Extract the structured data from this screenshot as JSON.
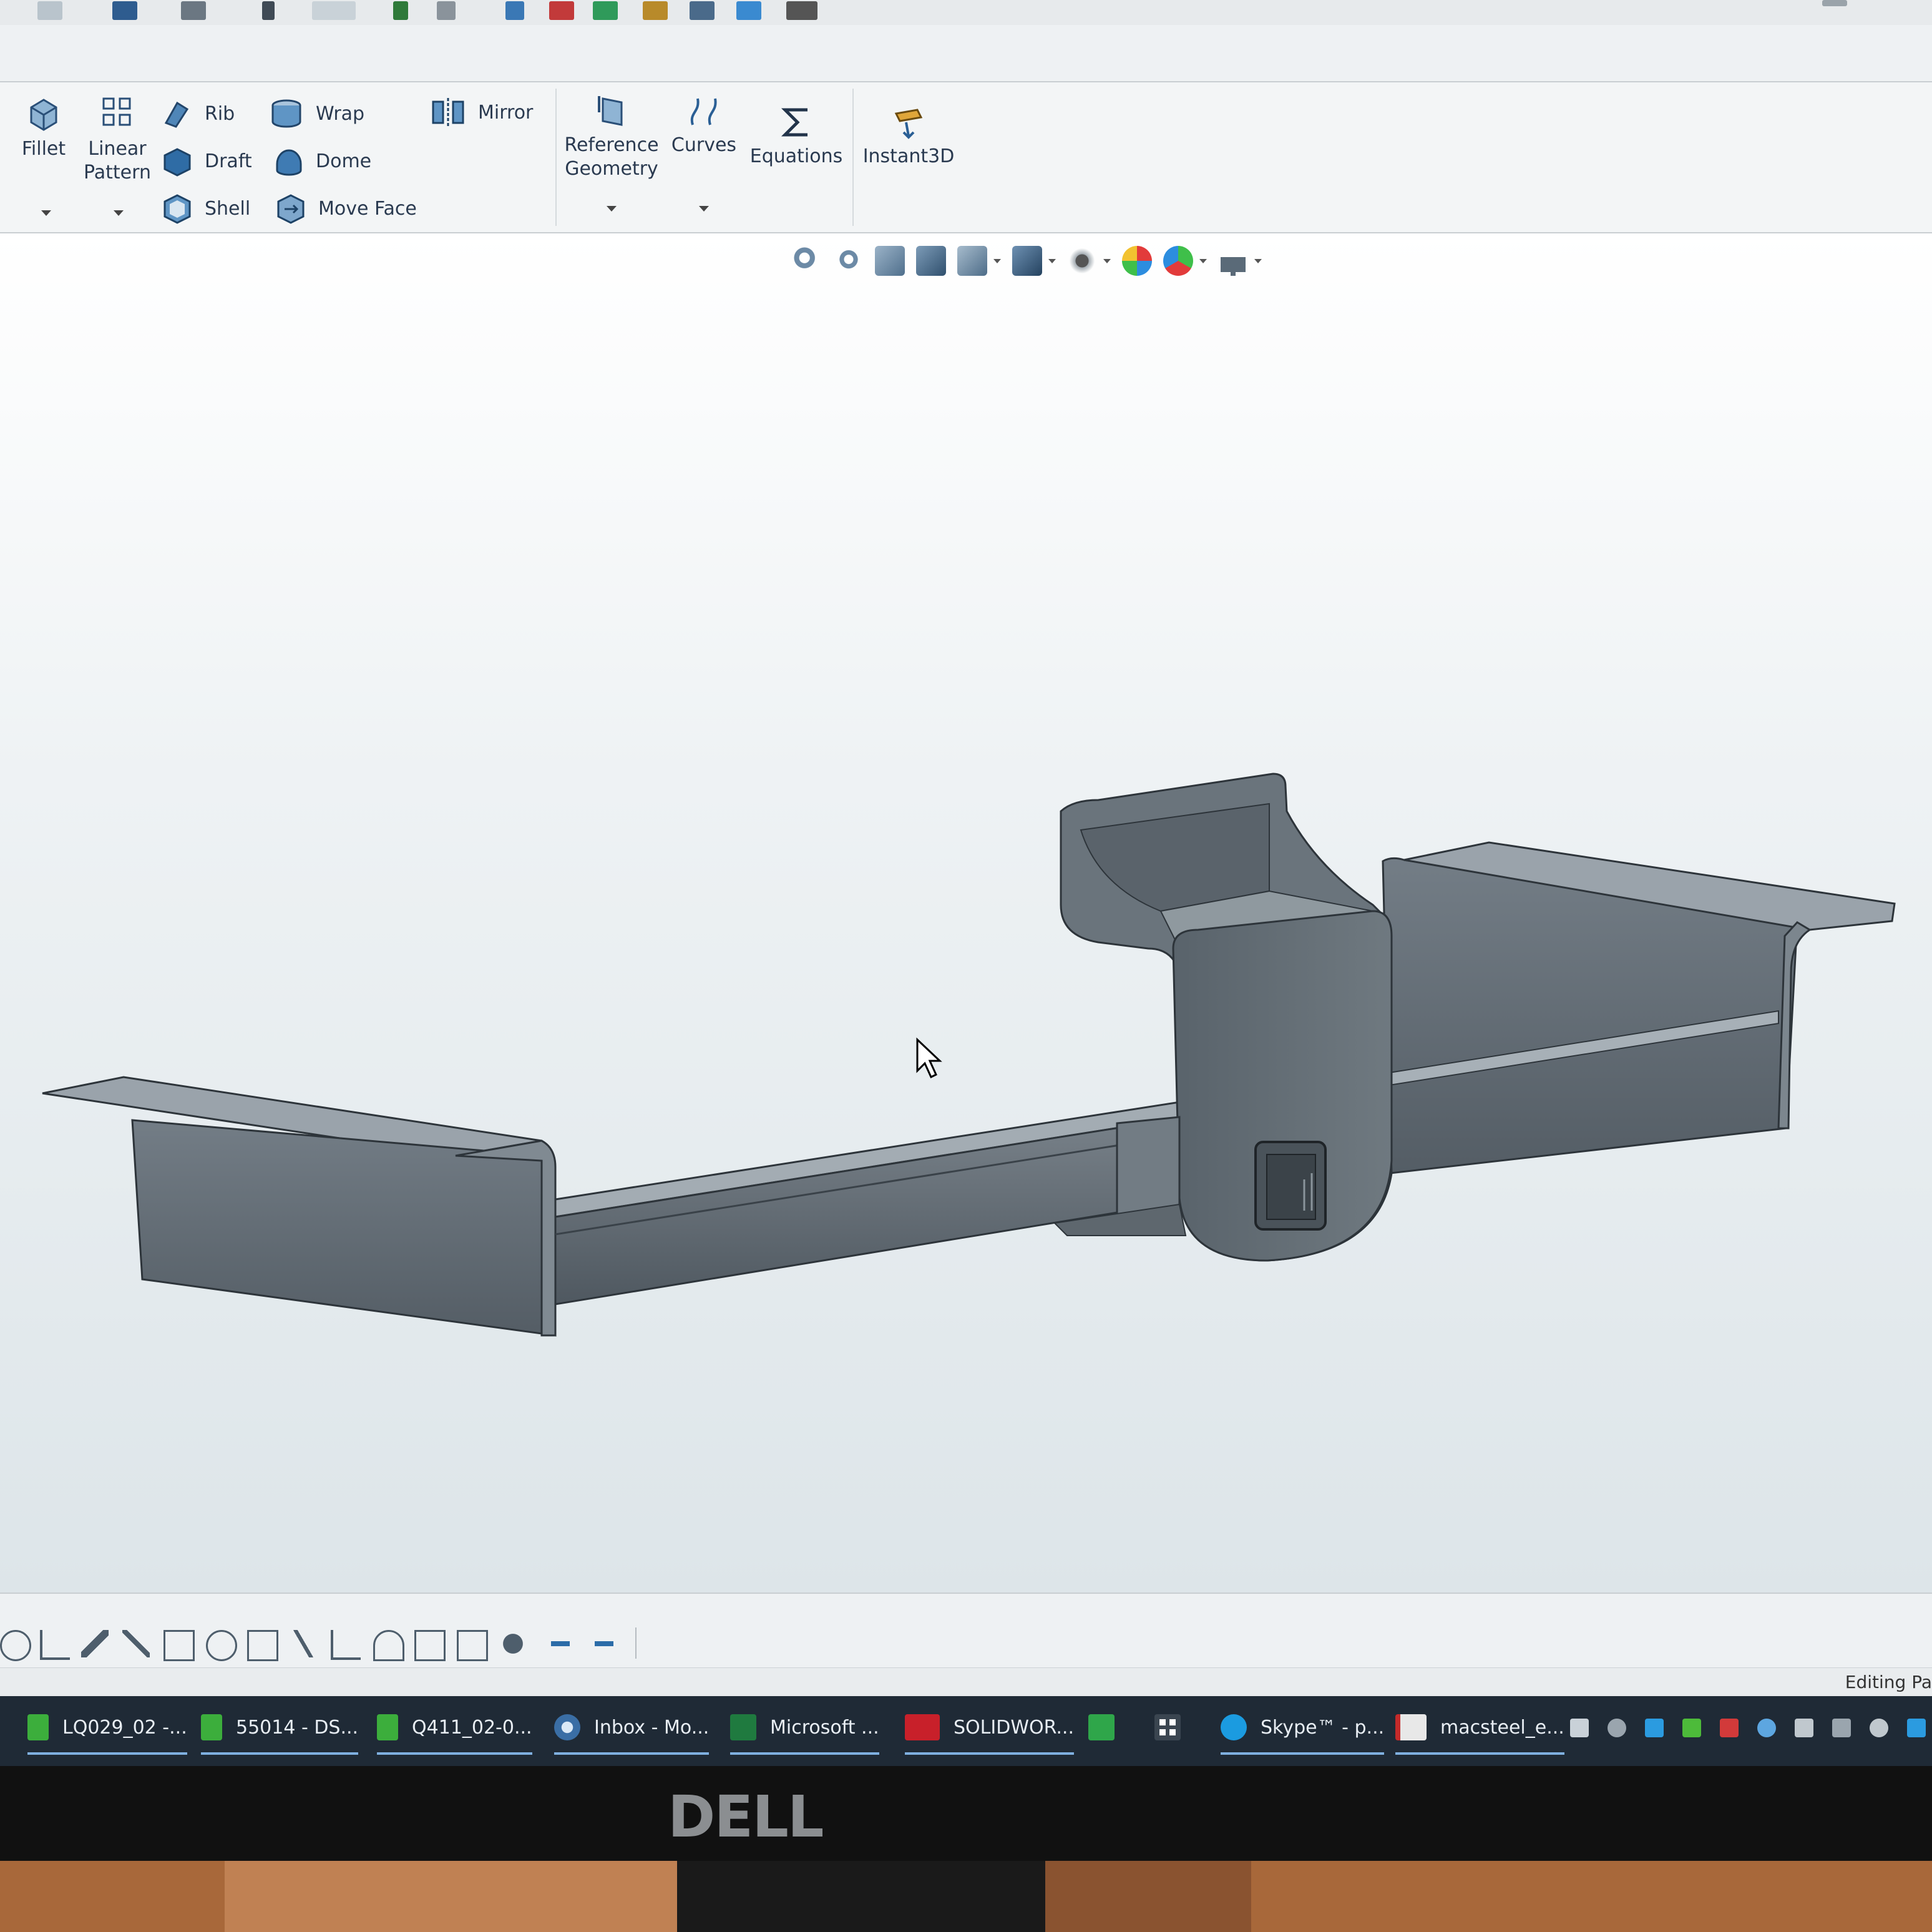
{
  "ribbon": {
    "fillet": "Fillet",
    "linear_pattern": [
      "Linear",
      "Pattern"
    ],
    "rib": "Rib",
    "draft": "Draft",
    "shell": "Shell",
    "wrap": "Wrap",
    "dome": "Dome",
    "move_face": "Move Face",
    "mirror": "Mirror",
    "reference_geometry": [
      "Reference",
      "Geometry"
    ],
    "curves": "Curves",
    "equations": "Equations",
    "instant3d": "Instant3D"
  },
  "status": {
    "text": "Editing Pa"
  },
  "taskbar": {
    "items": [
      {
        "label": "LQ029_02 -...",
        "icon": "green-file-icon"
      },
      {
        "label": "55014 - DS...",
        "icon": "green-file-icon"
      },
      {
        "label": "Q411_02-0...",
        "icon": "green-file-icon"
      },
      {
        "label": "Inbox - Mo...",
        "icon": "thunderbird-icon"
      },
      {
        "label": "Microsoft ...",
        "icon": "excel-icon"
      },
      {
        "label": "SOLIDWOR...",
        "icon": "solidworks-icon"
      },
      {
        "label": "Skype™ - p...",
        "icon": "skype-icon"
      },
      {
        "label": "macsteel_e...",
        "icon": "pdf-icon"
      }
    ]
  },
  "monitor": {
    "brand": "DELL"
  },
  "colors": {
    "accent": "#1f6fb8",
    "taskbar": "#1f2a36",
    "model_dark": "#4d5760",
    "model_mid": "#6f7a83",
    "model_light": "#9aa4ac"
  }
}
